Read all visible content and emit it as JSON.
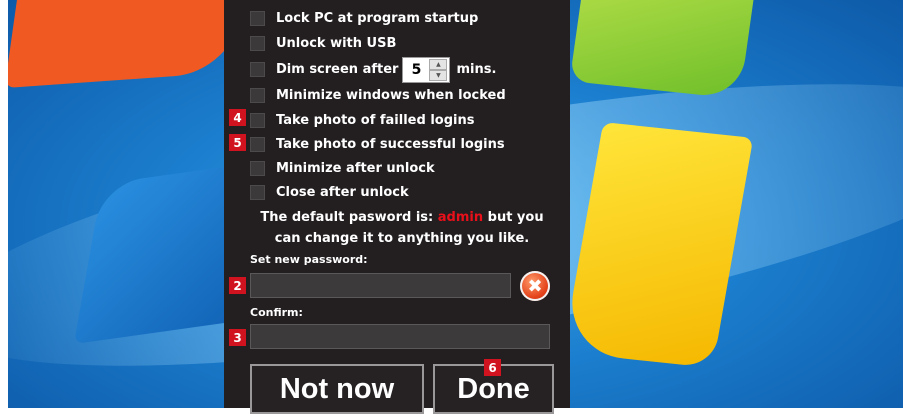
{
  "options": [
    {
      "label": "Lock PC at program startup"
    },
    {
      "label": "Unlock with USB"
    },
    {
      "label": "Dim screen after"
    },
    {
      "label": "Minimize windows when locked"
    },
    {
      "label": "Take photo of failled logins"
    },
    {
      "label": "Take photo of successful logins"
    },
    {
      "label": "Minimize after unlock"
    },
    {
      "label": "Close after unlock"
    }
  ],
  "dim": {
    "value": "5",
    "unit": "mins."
  },
  "info": {
    "line1_prefix": "The default pasword is: ",
    "default_password": "admin",
    "line1_suffix": " but you",
    "line2": "can change it to anything you like."
  },
  "password": {
    "label": "Set new password:",
    "value": ""
  },
  "confirm": {
    "label": "Confirm:",
    "value": ""
  },
  "buttons": {
    "not_now": "Not now",
    "done": "Done",
    "clear_icon": "✖"
  },
  "markers": {
    "m2": "2",
    "m3": "3",
    "m4": "4",
    "m5": "5",
    "m6": "6"
  },
  "colors": {
    "dialog_bg": "#231f20",
    "default_password": "#e8101a",
    "marker": "#d1121f"
  }
}
